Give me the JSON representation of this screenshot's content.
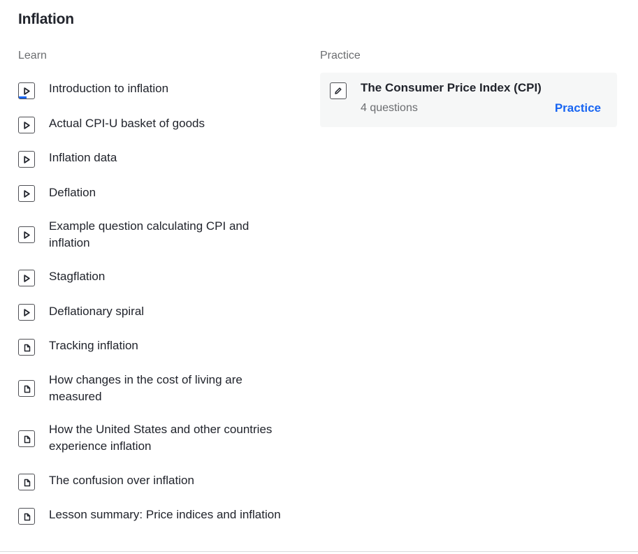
{
  "unit": {
    "title": "Inflation"
  },
  "learn": {
    "label": "Learn",
    "items": [
      {
        "type": "video",
        "title": "Introduction to inflation",
        "progress": 0.5
      },
      {
        "type": "video",
        "title": "Actual CPI-U basket of goods"
      },
      {
        "type": "video",
        "title": "Inflation data"
      },
      {
        "type": "video",
        "title": "Deflation"
      },
      {
        "type": "video",
        "title": "Example question calculating CPI and inflation"
      },
      {
        "type": "video",
        "title": "Stagflation"
      },
      {
        "type": "video",
        "title": "Deflationary spiral"
      },
      {
        "type": "article",
        "title": "Tracking inflation"
      },
      {
        "type": "article",
        "title": "How changes in the cost of living are measured"
      },
      {
        "type": "article",
        "title": "How the United States and other countries experience inflation"
      },
      {
        "type": "article",
        "title": "The confusion over inflation"
      },
      {
        "type": "article",
        "title": "Lesson summary: Price indices and inflation"
      }
    ]
  },
  "practice": {
    "label": "Practice",
    "card": {
      "title": "The Consumer Price Index (CPI)",
      "subtitle": "4 questions",
      "action_label": "Practice",
      "icon": "pencil-icon"
    }
  },
  "colors": {
    "accent": "#1865f2",
    "text": "#21242c",
    "muted": "#6b6d70",
    "card_bg": "#f6f7f7"
  }
}
